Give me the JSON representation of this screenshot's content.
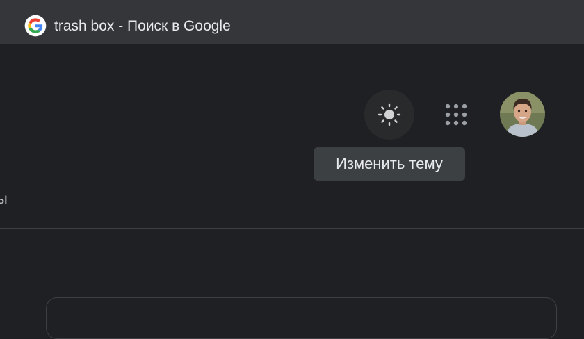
{
  "tab": {
    "favicon": "google-g-icon",
    "title": "trash box - Поиск в Google"
  },
  "header": {
    "theme_button_icon": "sun-icon",
    "apps_button_icon": "apps-grid-icon",
    "avatar_icon": "user-avatar"
  },
  "tooltip": {
    "text": "Изменить тему"
  },
  "nav": {
    "partial_label": "ты"
  },
  "colors": {
    "background": "#1f2023",
    "tabbar": "#35363a",
    "tooltip_bg": "#3c4043",
    "text_light": "#e8eaed",
    "icon_grey": "#9aa0a6",
    "sun_icon": "#d0d2d4",
    "google_blue": "#4285F4",
    "google_red": "#EA4335",
    "google_yellow": "#FBBC05",
    "google_green": "#34A853"
  }
}
